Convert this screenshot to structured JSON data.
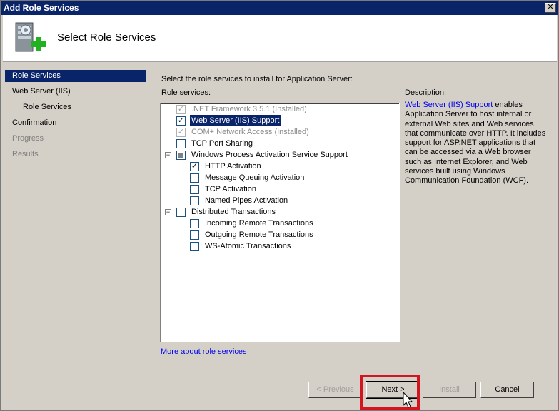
{
  "window": {
    "title": "Add Role Services",
    "close_glyph": "✕"
  },
  "header": {
    "title": "Select Role Services",
    "icon": "server-plus-icon"
  },
  "nav": {
    "items": [
      {
        "label": "Role Services",
        "active": true
      },
      {
        "label": "Web Server (IIS)",
        "active": false
      },
      {
        "label": "Role Services",
        "active": false
      },
      {
        "label": "Confirmation",
        "active": false
      },
      {
        "label": "Progress",
        "active": false
      },
      {
        "label": "Results",
        "active": false
      }
    ]
  },
  "main": {
    "intro": "Select the role services to install for Application Server:",
    "role_services_label": "Role services:",
    "tree": [
      {
        "label": ".NET Framework 3.5.1  (Installed)",
        "checked": true,
        "disabled": true
      },
      {
        "label": "Web Server (IIS) Support",
        "checked": true,
        "selected": true
      },
      {
        "label": "COM+ Network Access  (Installed)",
        "checked": true,
        "disabled": true
      },
      {
        "label": "TCP Port Sharing",
        "checked": false
      },
      {
        "label": "Windows Process Activation Service Support",
        "checked": false,
        "partial": true,
        "expander": "−"
      },
      {
        "label": "HTTP Activation",
        "checked": true
      },
      {
        "label": "Message Queuing Activation",
        "checked": false
      },
      {
        "label": "TCP Activation",
        "checked": false
      },
      {
        "label": "Named Pipes Activation",
        "checked": false
      },
      {
        "label": "Distributed Transactions",
        "checked": false,
        "expander": "−"
      },
      {
        "label": "Incoming Remote Transactions",
        "checked": false
      },
      {
        "label": "Outgoing Remote Transactions",
        "checked": false
      },
      {
        "label": "WS-Atomic Transactions",
        "checked": false
      }
    ],
    "description_label": "Description:",
    "description_link": "Web Server (IIS) Support",
    "description_text": " enables Application Server to host internal or external Web sites and Web services that communicate over HTTP. It includes support for ASP.NET applications that can be accessed via a Web browser such as Internet Explorer, and Web services built using Windows Communication Foundation (WCF).",
    "more_link": "More about role services"
  },
  "footer": {
    "previous": "< Previous",
    "next": "Next >",
    "install": "Install",
    "cancel": "Cancel"
  },
  "colors": {
    "selection": "#0a246a",
    "highlight_box": "#d4141e"
  }
}
